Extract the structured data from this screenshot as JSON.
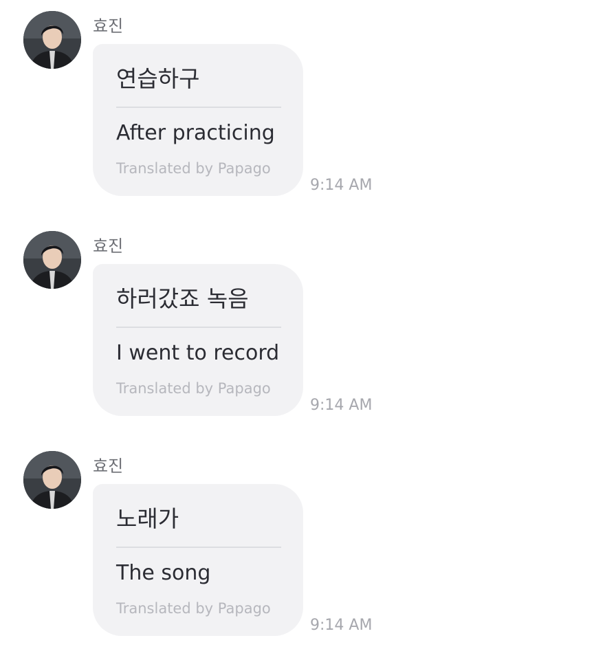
{
  "messages": [
    {
      "sender": "효진",
      "original": "연습하구",
      "translation": "After practicing",
      "credit": "Translated by Papago",
      "time": "9:14 AM"
    },
    {
      "sender": "효진",
      "original": "하러갔죠 녹음",
      "translation": "I went to record",
      "credit": "Translated by Papago",
      "time": "9:14 AM"
    },
    {
      "sender": "효진",
      "original": "노래가",
      "translation": "The song",
      "credit": "Translated by Papago",
      "time": "9:14 AM"
    }
  ],
  "icons": {
    "avatar": "profile-photo"
  },
  "colors": {
    "bubble": "#f2f2f4",
    "text": "#2b2c33",
    "muted": "#b6b7bd",
    "timestamp": "#a6a7ad"
  }
}
